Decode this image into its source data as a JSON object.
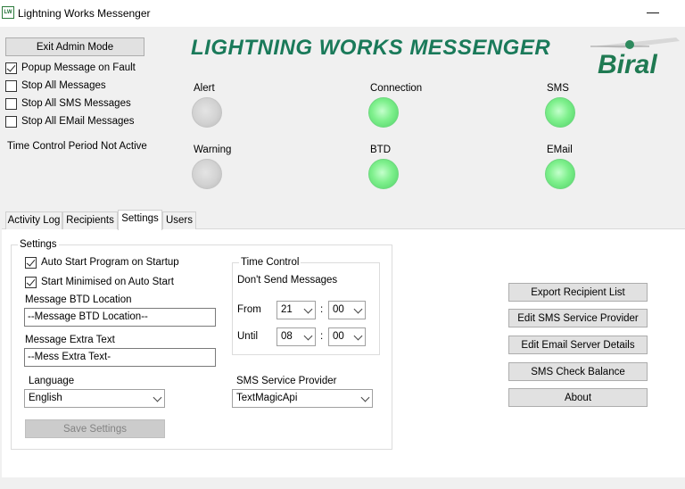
{
  "window": {
    "title": "Lightning Works Messenger",
    "icon_text": "LW",
    "minimize_glyph": "—"
  },
  "header": {
    "heading": "LIGHTNING WORKS MESSENGER",
    "logo_text": "Biral"
  },
  "admin": {
    "exit_button": "Exit Admin Mode",
    "options": [
      {
        "label": "Popup Message on Fault",
        "checked": true
      },
      {
        "label": "Stop All Messages",
        "checked": false
      },
      {
        "label": "Stop All SMS Messages",
        "checked": false
      },
      {
        "label": "Stop All EMail Messages",
        "checked": false
      }
    ],
    "time_status": "Time Control Period Not Active"
  },
  "indicators": [
    {
      "label": "Alert",
      "state": "off"
    },
    {
      "label": "Connection",
      "state": "on"
    },
    {
      "label": "SMS",
      "state": "on"
    },
    {
      "label": "Warning",
      "state": "off"
    },
    {
      "label": "BTD",
      "state": "on"
    },
    {
      "label": "EMail",
      "state": "on"
    }
  ],
  "tabs": [
    "Activity Log",
    "Recipients",
    "Settings",
    "Users"
  ],
  "active_tab": "Settings",
  "settings": {
    "group_label": "Settings",
    "auto_start_label": "Auto Start Program on Startup",
    "auto_start_checked": true,
    "start_minimised_label": "Start Minimised on Auto Start",
    "start_minimised_checked": true,
    "btd_location_label": "Message BTD Location",
    "btd_location_value": "--Message BTD Location--",
    "extra_text_label": "Message Extra Text",
    "extra_text_value": "--Mess Extra Text-",
    "language_label": "Language",
    "language_value": "English",
    "save_button": "Save Settings",
    "time_control": {
      "group_label": "Time Control",
      "dont_send_label": "Don't Send Messages",
      "from_label": "From",
      "from_hour": "21",
      "from_minute": "00",
      "until_label": "Until",
      "until_hour": "08",
      "until_minute": "00",
      "separator": ":"
    },
    "sms_provider_label": "SMS Service Provider",
    "sms_provider_value": "TextMagicApi"
  },
  "actions": {
    "export_recipients": "Export Recipient List",
    "edit_sms_provider": "Edit SMS Service Provider",
    "edit_email_server": "Edit Email Server Details",
    "sms_check_balance": "SMS Check Balance",
    "about": "About"
  },
  "colors": {
    "heading": "#1a7a5a",
    "led_on": "#7ff08d",
    "led_off": "#d2d2d2",
    "logo": "#1f7a52"
  }
}
